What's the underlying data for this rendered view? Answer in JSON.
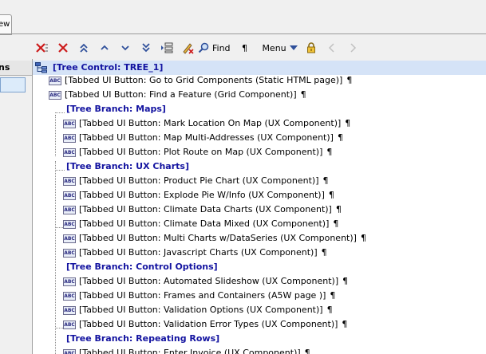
{
  "tab": {
    "label": "ew"
  },
  "left_panel": {
    "header": "ns"
  },
  "toolbar": {
    "find_label": "Find",
    "pilcrow": "¶",
    "menu_label": "Menu"
  },
  "tree": {
    "root": "[Tree Control: TREE_1]",
    "top_items": [
      "[Tabbed UI Button: Go to Grid Components (Static HTML page)]",
      "[Tabbed UI Button: Find a Feature (Grid Component)]"
    ],
    "branches": [
      {
        "label": "[Tree Branch: Maps]",
        "items": [
          "[Tabbed UI Button: Mark Location On Map (UX Component)]",
          "[Tabbed UI Button: Map Multi-Addresses (UX Component)]",
          "[Tabbed UI Button: Plot Route on Map (UX Component)]"
        ]
      },
      {
        "label": "[Tree Branch: UX Charts]",
        "items": [
          "[Tabbed UI Button: Product Pie Chart (UX Component)]",
          "[Tabbed UI Button: Explode Pie W/Info (UX Component)]",
          "[Tabbed UI Button: Climate Data Charts (UX Component)]",
          "[Tabbed UI Button: Climate Data Mixed (UX Component)]",
          "[Tabbed UI Button: Multi Charts w/DataSeries (UX Component)]",
          "[Tabbed UI Button: Javascript Charts (UX Component)]"
        ]
      },
      {
        "label": "[Tree Branch: Control Options]",
        "items": [
          "[Tabbed UI Button: Automated Slideshow (UX Component)]",
          "[Tabbed UI Button: Frames and Containers (A5W page )]",
          "[Tabbed UI Button: Validation Options (UX Component)]",
          "[Tabbed UI Button: Validation Error Types (UX Component)]"
        ]
      },
      {
        "label": "[Tree Branch: Repeating Rows]",
        "items": [
          "[Tabbed UI Button: Enter Invoice (UX Component)]"
        ]
      }
    ],
    "pilcrow": "¶",
    "item_icon_text": "ABC"
  }
}
